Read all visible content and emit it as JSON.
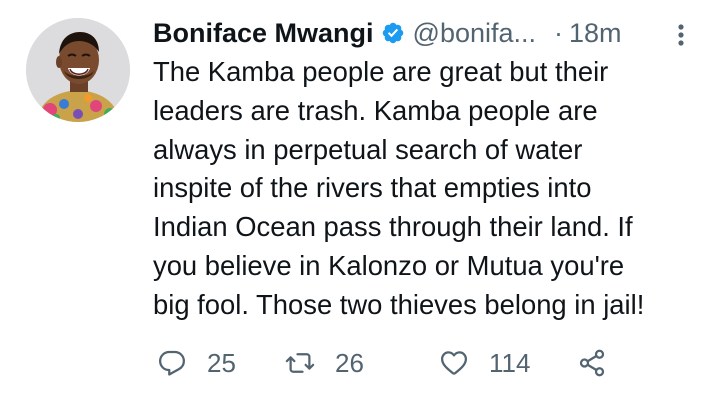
{
  "author": {
    "display_name": "Boniface Mwangi",
    "handle": "@bonifa...",
    "verified": true,
    "verified_badge_color": "#1d9bf0",
    "avatar_icon": "profile-photo"
  },
  "timestamp": "18m",
  "separator": "·",
  "body_lines": [
    "The Kamba people are great but their",
    "leaders are trash. Kamba people are",
    "always in perpetual search of water",
    "inspite of the rivers that empties into",
    "Indian Ocean pass through their land. If",
    "you believe in Kalonzo or Mutua you're",
    "big fool. Those two thieves belong in jail!"
  ],
  "actions": {
    "reply": {
      "icon": "reply-icon",
      "count": "25"
    },
    "retweet": {
      "icon": "retweet-icon",
      "count": "26"
    },
    "like": {
      "icon": "like-icon",
      "count": "114"
    },
    "share": {
      "icon": "share-icon"
    }
  },
  "colors": {
    "text_primary": "#0f1419",
    "text_secondary": "#536471",
    "background": "#ffffff"
  }
}
